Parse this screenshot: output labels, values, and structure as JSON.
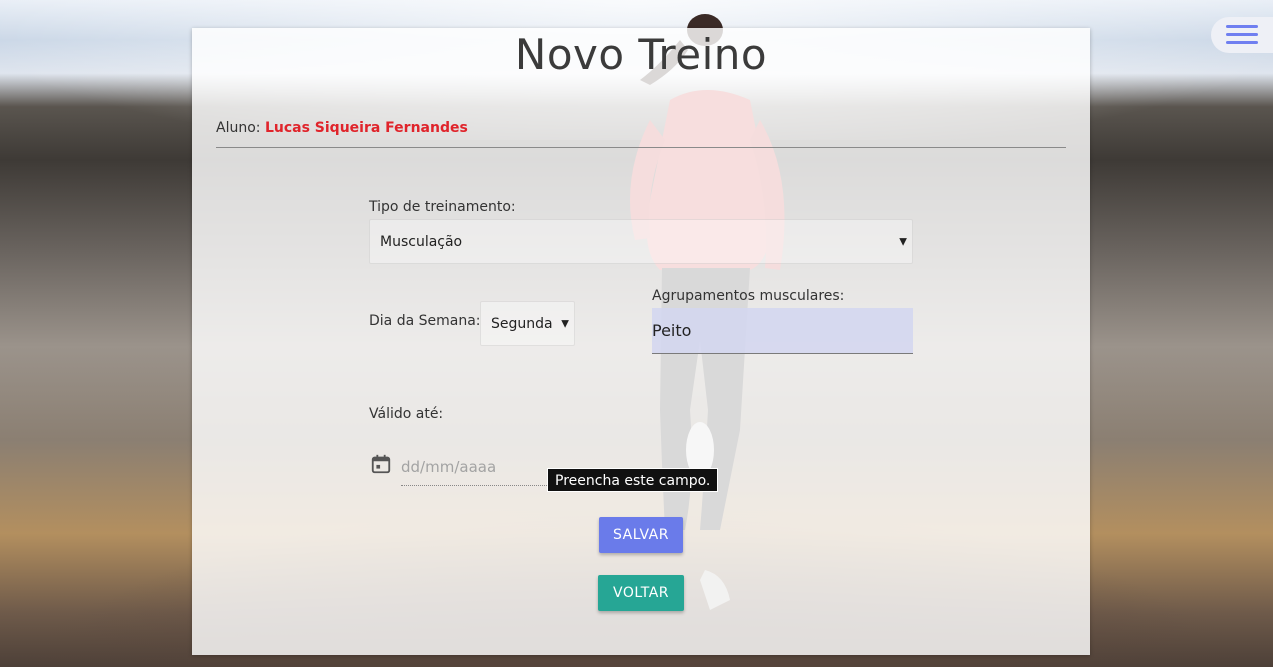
{
  "header": {
    "title": "Novo Treino"
  },
  "student": {
    "label": "Aluno:",
    "name": "Lucas Siqueira Fernandes"
  },
  "form": {
    "training_type": {
      "label": "Tipo de treinamento:",
      "value": "Musculação"
    },
    "weekday": {
      "label": "Dia da Semana:",
      "value": "Segunda"
    },
    "muscle_groups": {
      "label": "Agrupamentos musculares:",
      "value": "Peito"
    },
    "valid_until": {
      "label": "Válido até:",
      "placeholder": "dd/mm/aaaa"
    },
    "validation_tooltip": "Preencha este campo."
  },
  "actions": {
    "save_label": "SALVAR",
    "back_label": "VOLTAR"
  },
  "colors": {
    "accent": "#6a7bea",
    "secondary": "#26a695",
    "student_name": "#e0242b",
    "menu_icon": "#6f7ff0"
  },
  "icons": {
    "menu": "hamburger-menu-icon",
    "date": "calendar-icon",
    "dropdown": "chevron-down-icon"
  }
}
